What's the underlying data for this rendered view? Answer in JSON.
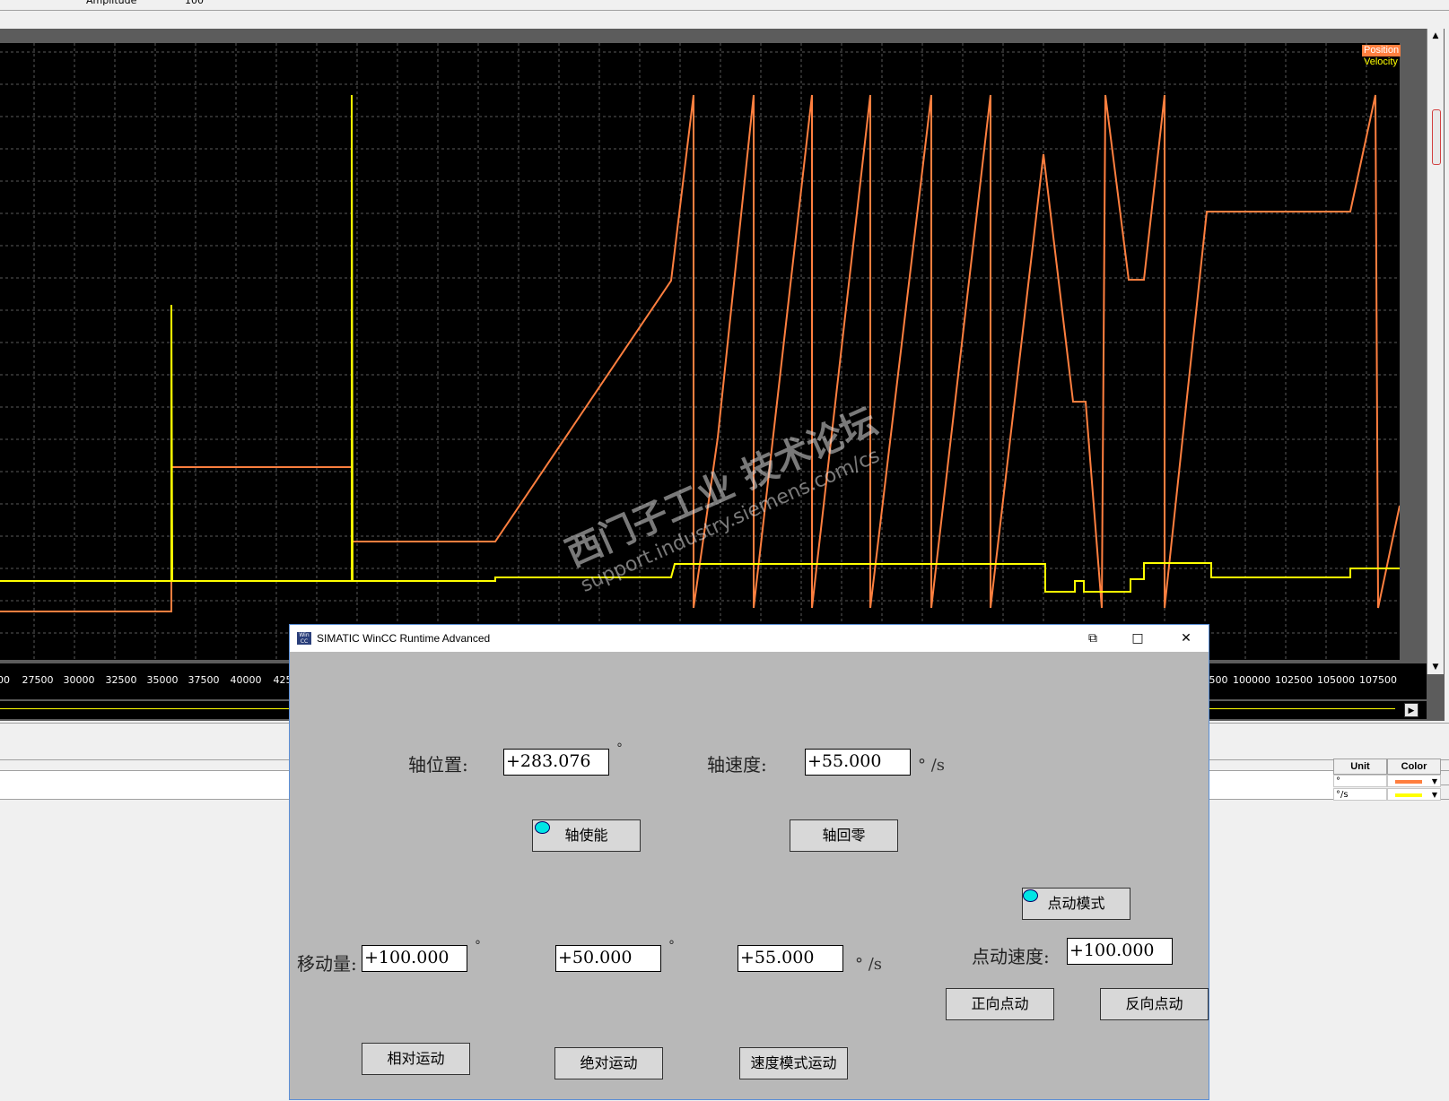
{
  "toolbar": {
    "amplitude_label": "Amplitude",
    "value_label": "100"
  },
  "trace": {
    "legend": [
      {
        "name": "Position",
        "color": "#ff7f3f"
      },
      {
        "name": "Velocity",
        "color": "#ffff00"
      }
    ],
    "x_ticks_left": [
      "00",
      "27500",
      "30000",
      "32500",
      "35000",
      "37500",
      "40000",
      "425"
    ],
    "x_ticks_right": [
      "500",
      "100000",
      "102500",
      "105000",
      "107500"
    ],
    "colors": {
      "position": "#ff7f3f",
      "velocity": "#ffff00",
      "grid": "#5a5a5a",
      "background": "#000000"
    }
  },
  "signal_table": {
    "headers": {
      "unit": "Unit",
      "color": "Color"
    },
    "rows": [
      {
        "unit": "°",
        "color": "#ff7f3f"
      },
      {
        "unit": "°/s",
        "color": "#ffff00"
      }
    ]
  },
  "wincc": {
    "title": "SIMATIC WinCC Runtime Advanced",
    "axis_position_label": "轴位置:",
    "axis_position_value": "+283.076",
    "axis_position_unit": "°",
    "axis_velocity_label": "轴速度:",
    "axis_velocity_value": "+55.000",
    "axis_velocity_unit": "° /s",
    "enable_button": "轴使能",
    "home_button": "轴回零",
    "jog_mode_button": "点动模式",
    "move_amount_label": "移动量:",
    "rel_distance_value": "+100.000",
    "rel_distance_unit": "°",
    "abs_position_value": "+50.000",
    "abs_position_unit": "°",
    "velocity_mode_value": "+55.000",
    "velocity_mode_unit": "° /s",
    "jog_velocity_label": "点动速度:",
    "jog_velocity_value": "+100.000",
    "jog_forward_button": "正向点动",
    "jog_backward_button": "反向点动",
    "relative_move_button": "相对运动",
    "absolute_move_button": "绝对运动",
    "velocity_move_button": "速度模式运动"
  },
  "watermark": {
    "line1": "西门子工业  技术论坛",
    "line2": "support.industry.siemens.com/cs"
  }
}
